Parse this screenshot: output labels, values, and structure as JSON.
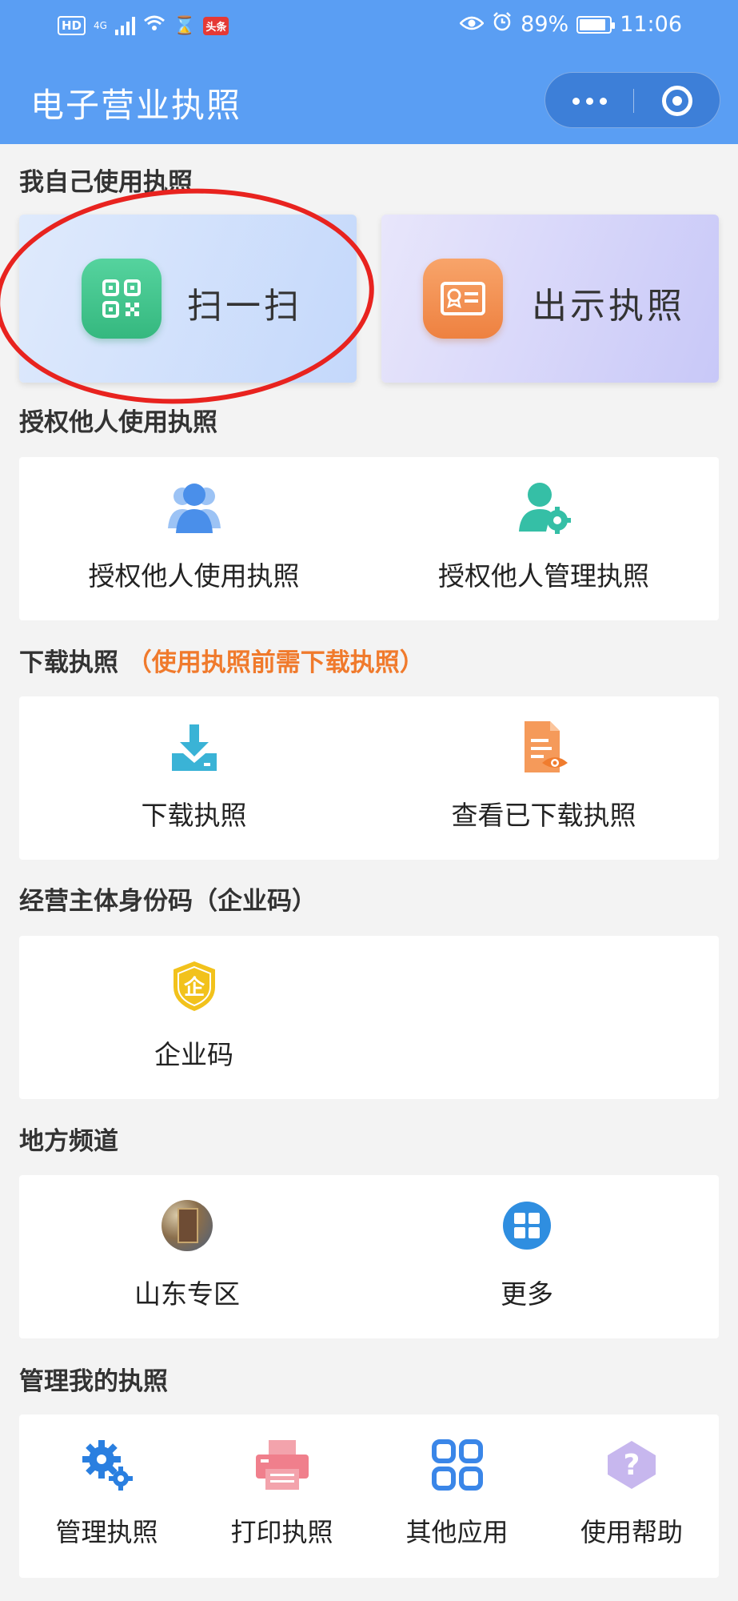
{
  "status_bar": {
    "left_hd": "HD",
    "left_network": "4G",
    "news_badge": "头条",
    "battery": "89%",
    "battery_level": 0.89,
    "time": "11:06"
  },
  "nav": {
    "title": "电子营业执照"
  },
  "sections": {
    "self_use": {
      "title": "我自己使用执照"
    },
    "authorize": {
      "title": "授权他人使用执照"
    },
    "download": {
      "title": "下载执照",
      "note": "（使用执照前需下载执照）"
    },
    "enterprise_code": {
      "title": "经营主体身份码（企业码）"
    },
    "local": {
      "title": "地方频道"
    },
    "manage": {
      "title": "管理我的执照"
    }
  },
  "self_use_cards": [
    {
      "label": "扫一扫",
      "icon": "qr-code-icon",
      "color": "#3fc48c"
    },
    {
      "label": "出示执照",
      "icon": "license-card-icon",
      "color": "#f28a4a"
    }
  ],
  "authorize_items": [
    {
      "label": "授权他人使用执照",
      "icon": "users-icon"
    },
    {
      "label": "授权他人管理执照",
      "icon": "user-gear-icon"
    }
  ],
  "download_items": [
    {
      "label": "下载执照",
      "icon": "download-icon"
    },
    {
      "label": "查看已下载执照",
      "icon": "document-view-icon"
    }
  ],
  "enterprise_items": [
    {
      "label": "企业码",
      "icon": "enterprise-shield-icon",
      "glyph": "企"
    }
  ],
  "local_items": [
    {
      "label": "山东专区",
      "icon": "shandong-photo-icon"
    },
    {
      "label": "更多",
      "icon": "grid-more-icon"
    }
  ],
  "manage_items": [
    {
      "label": "管理执照",
      "icon": "gears-icon"
    },
    {
      "label": "打印执照",
      "icon": "printer-icon"
    },
    {
      "label": "其他应用",
      "icon": "apps-icon"
    },
    {
      "label": "使用帮助",
      "icon": "help-icon",
      "glyph": "?"
    }
  ],
  "colors": {
    "header": "#5a9ef3",
    "accent_note": "#f07a2c",
    "highlight_ellipse": "#e8231f"
  }
}
